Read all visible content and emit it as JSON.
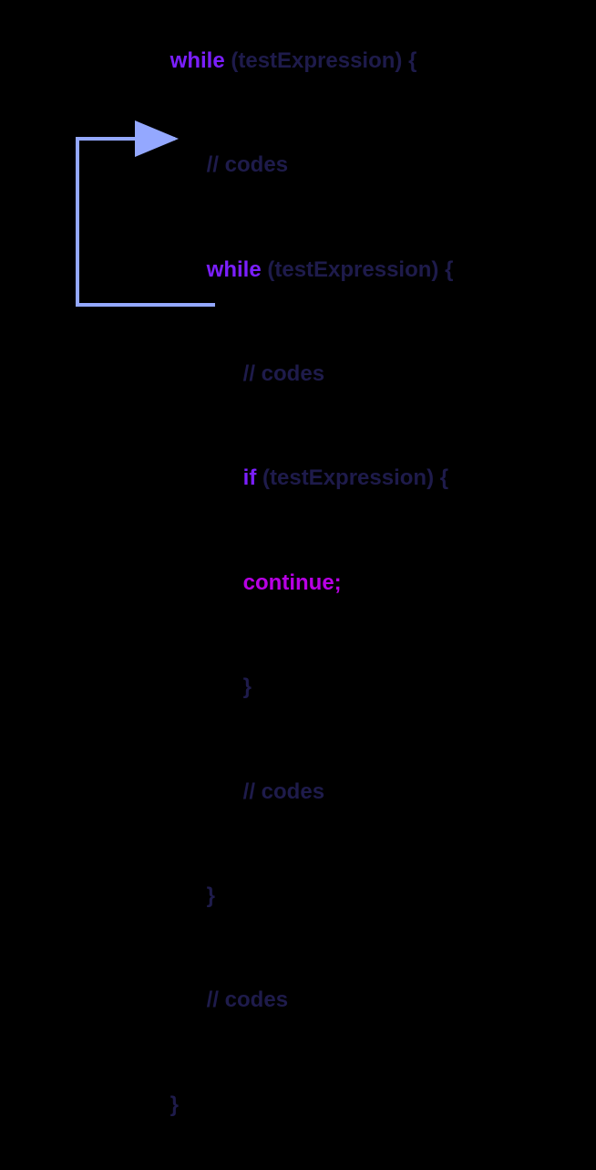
{
  "code": {
    "line1_while": "while",
    "line1_rest": " (testExpression) {",
    "line2_comment": "// codes",
    "line3_while": "while",
    "line3_rest": " (testExpression) {",
    "line4_comment": "// codes",
    "line5_if": "if",
    "line5_rest": " (testExpression) {",
    "line6_continue": "continue;",
    "line7_brace": "}",
    "line8_comment": "// codes",
    "line9_brace": "}",
    "line10_comment": "// codes",
    "line11_brace": "}"
  },
  "colors": {
    "keyword_purple": "#7b1fff",
    "keyword_magenta": "#b800e5",
    "text_dark": "#1e1b4b",
    "arrow": "#94a8ff",
    "background": "#000000"
  },
  "arrow": {
    "from": "continue-statement",
    "to": "inner-while-loop"
  }
}
